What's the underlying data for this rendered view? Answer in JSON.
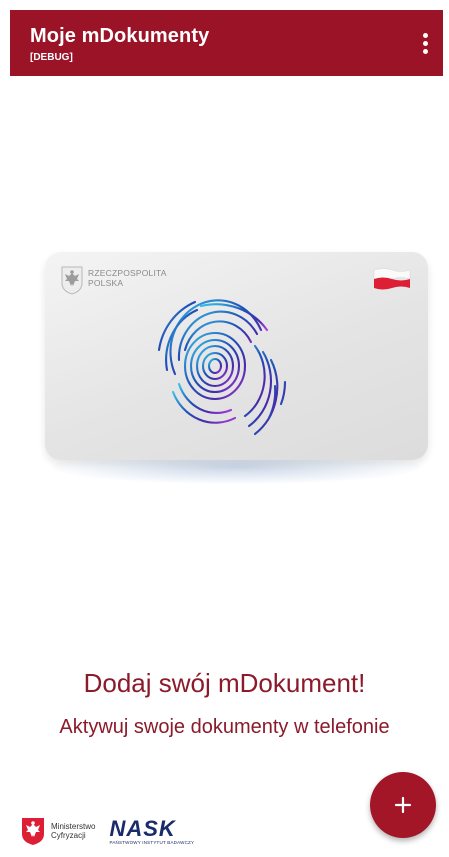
{
  "app_bar": {
    "title": "Moje mDokumenty",
    "subtitle": "[DEBUG]",
    "menu_icon": "more-vert-icon",
    "color": "#9a1326"
  },
  "card": {
    "issuer_line1": "RZECZPOSPOLITA",
    "issuer_line2": "POLSKA",
    "emblem_icon": "polish-eagle-icon",
    "flag_icon": "polish-flag-icon",
    "graphic_icon": "fingerprint-icon"
  },
  "empty_state": {
    "headline": "Dodaj swój mDokument!",
    "subtitle": "Aktywuj swoje dokumenty w telefonie",
    "text_color": "#8b1a2a"
  },
  "footer": {
    "ministry_line1": "Ministerstwo",
    "ministry_line2": "Cyfryzacji",
    "nask_name": "NASK",
    "nask_tagline": "PAŃSTWOWY INSTYTUT BADAWCZY"
  },
  "fab": {
    "icon": "plus-icon",
    "color": "#a31628"
  }
}
